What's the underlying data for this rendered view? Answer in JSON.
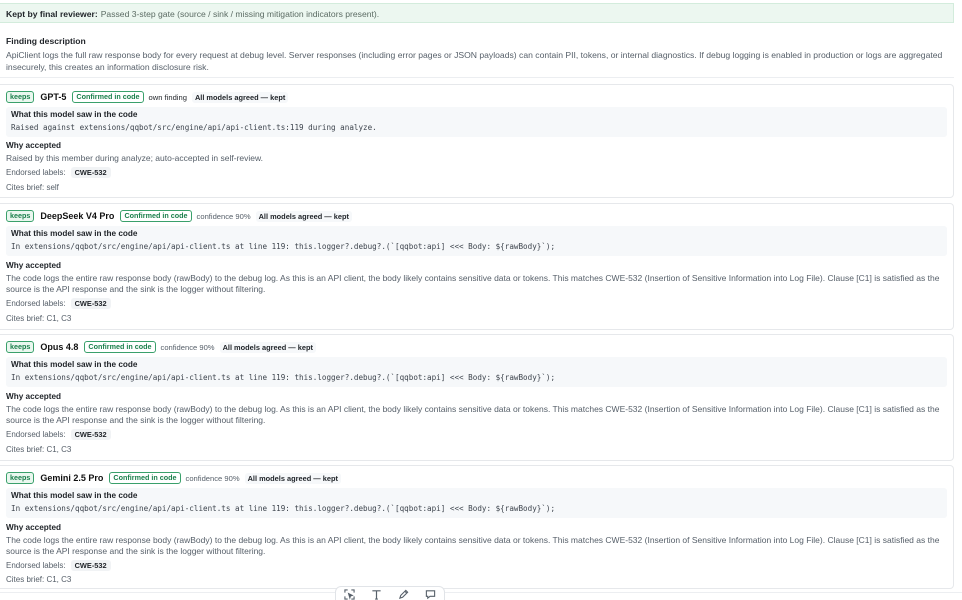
{
  "banner": {
    "label": "Kept by final reviewer:",
    "text": "Passed 3-step gate (source / sink / missing mitigation indicators present)."
  },
  "finding": {
    "heading": "Finding description",
    "text": "ApiClient logs the full raw response body for every request at debug level. Server responses (including error pages or JSON payloads) can contain PII, tokens, or internal diagnostics. If debug logging is enabled in production or logs are aggregated insecurely, this creates an information disclosure risk."
  },
  "labels": {
    "saw_heading": "What this model saw in the code",
    "why_heading": "Why accepted",
    "endorsed": "Endorsed labels:"
  },
  "cards": [
    {
      "verdict": "keeps",
      "model": "GPT-5",
      "status": "Confirmed in code",
      "extra": "own finding",
      "agreement": "All models agreed — kept",
      "saw": "Raised against extensions/qqbot/src/engine/api/api-client.ts:119 during analyze.",
      "why": "Raised by this member during analyze; auto-accepted in self-review.",
      "label": "CWE-532",
      "cites": "Cites brief: self"
    },
    {
      "verdict": "keeps",
      "model": "DeepSeek V4 Pro",
      "status": "Confirmed in code",
      "extra": "confidence 90%",
      "agreement": "All models agreed — kept",
      "saw": "In extensions/qqbot/src/engine/api/api-client.ts at line 119: this.logger?.debug?.(`[qqbot:api] <<< Body: ${rawBody}`);",
      "why": "The code logs the entire raw response body (rawBody) to the debug log. As this is an API client, the body likely contains sensitive data or tokens. This matches CWE-532 (Insertion of Sensitive Information into Log File). Clause [C1] is satisfied as the source is the API response and the sink is the logger without filtering.",
      "label": "CWE-532",
      "cites": "Cites brief: C1, C3"
    },
    {
      "verdict": "keeps",
      "model": "Opus 4.8",
      "status": "Confirmed in code",
      "extra": "confidence 90%",
      "agreement": "All models agreed — kept",
      "saw": "In extensions/qqbot/src/engine/api/api-client.ts at line 119: this.logger?.debug?.(`[qqbot:api] <<< Body: ${rawBody}`);",
      "why": "The code logs the entire raw response body (rawBody) to the debug log. As this is an API client, the body likely contains sensitive data or tokens. This matches CWE-532 (Insertion of Sensitive Information into Log File). Clause [C1] is satisfied as the source is the API response and the sink is the logger without filtering.",
      "label": "CWE-532",
      "cites": "Cites brief: C1, C3"
    },
    {
      "verdict": "keeps",
      "model": "Gemini 2.5 Pro",
      "status": "Confirmed in code",
      "extra": "confidence 90%",
      "agreement": "All models agreed — kept",
      "saw": "In extensions/qqbot/src/engine/api/api-client.ts at line 119: this.logger?.debug?.(`[qqbot:api] <<< Body: ${rawBody}`);",
      "why": "The code logs the entire raw response body (rawBody) to the debug log. As this is an API client, the body likely contains sensitive data or tokens. This matches CWE-532 (Insertion of Sensitive Information into Log File). Clause [C1] is satisfied as the source is the API response and the sink is the logger without filtering.",
      "label": "CWE-532",
      "cites": "Cites brief: C1, C3"
    }
  ],
  "toolbar": {
    "tools": [
      "select-icon",
      "text-icon",
      "pen-icon",
      "comment-icon"
    ]
  }
}
